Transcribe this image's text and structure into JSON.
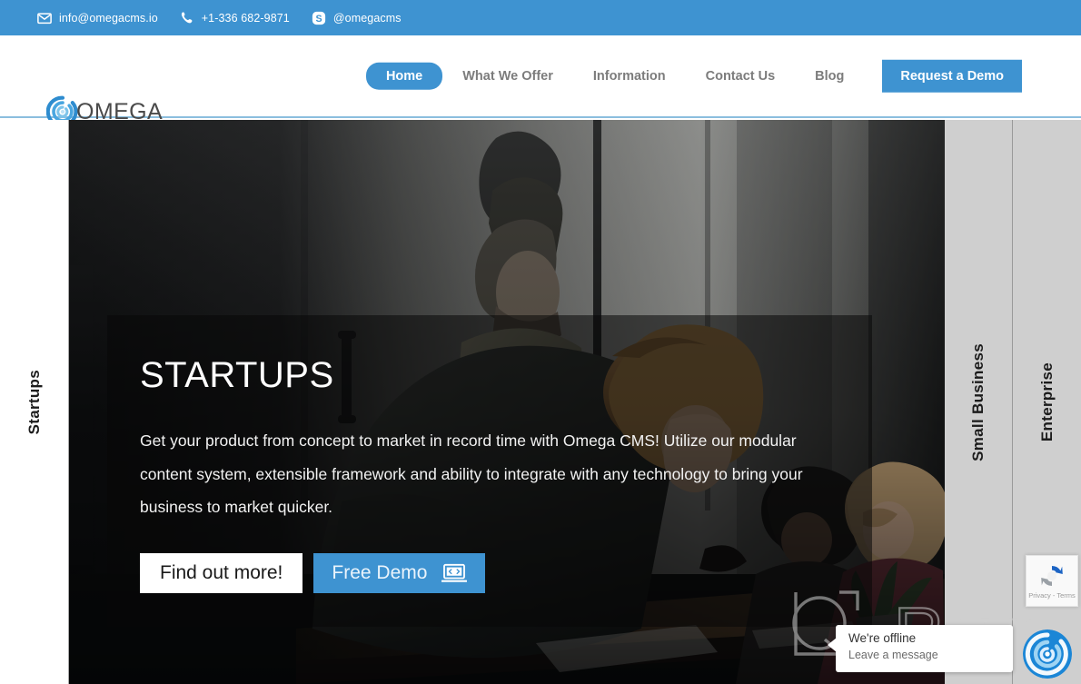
{
  "topbar": {
    "background": "#3e93d1",
    "contacts": [
      {
        "icon": "envelope-icon",
        "text": "info@omegacms.io"
      },
      {
        "icon": "phone-icon",
        "text": "+1-336 682-9871"
      },
      {
        "icon": "skype-icon",
        "text": "@omegacms"
      }
    ]
  },
  "nav": {
    "logo_text": "OMEGA",
    "logo_icon": "omega-spiral-logo",
    "links": [
      {
        "label": "Home",
        "active": true
      },
      {
        "label": "What We Offer",
        "active": false
      },
      {
        "label": "Information",
        "active": false
      },
      {
        "label": "Contact Us",
        "active": false
      },
      {
        "label": "Blog",
        "active": false
      }
    ],
    "cta_label": "Request a Demo",
    "accent": "#3e93d1",
    "inactive_color": "#7c7c7c"
  },
  "hero": {
    "tabs": {
      "left": "Startups",
      "middle": "Small Business",
      "right": "Enterprise"
    },
    "title": "STARTUPS",
    "body": "Get your product from concept to market in record time with Omega CMS! Utilize our modular content system, extensible framework and ability to integrate with any technology to bring your business to market quicker.",
    "button_secondary": "Find out more!",
    "button_primary": "Free Demo",
    "button_primary_icon": "laptop-code-icon"
  },
  "watermark": {
    "text": "Revain"
  },
  "recaptcha": {
    "icon": "recaptcha-icon",
    "text": "Privacy - Terms"
  },
  "chat": {
    "line1": "We're offline",
    "line2": "Leave a message",
    "launcher_icon": "omega-spiral-chat-icon"
  }
}
